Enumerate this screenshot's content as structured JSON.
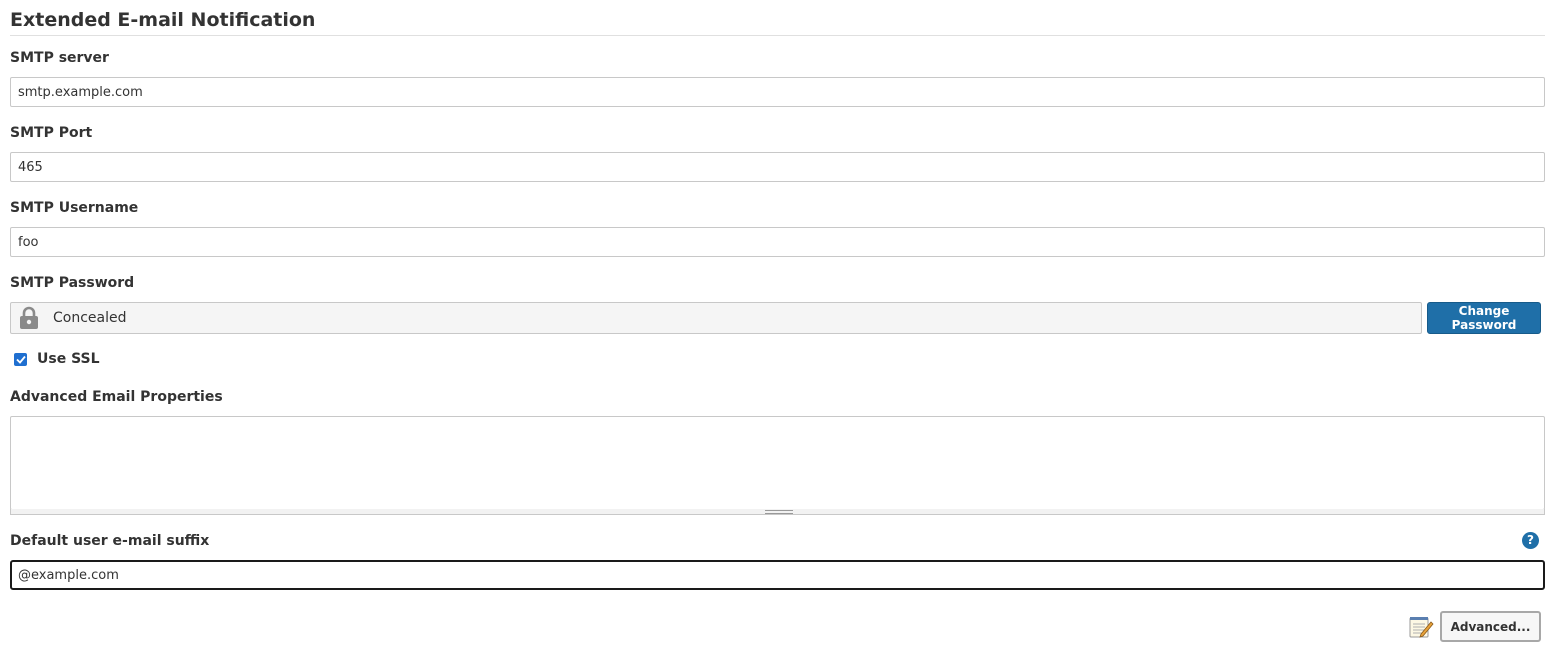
{
  "section": {
    "title": "Extended E-mail Notification"
  },
  "smtp_server": {
    "label": "SMTP server",
    "value": "smtp.example.com"
  },
  "smtp_port": {
    "label": "SMTP Port",
    "value": "465"
  },
  "smtp_username": {
    "label": "SMTP Username",
    "value": "foo"
  },
  "smtp_password": {
    "label": "SMTP Password",
    "concealed_text": "Concealed",
    "change_button_label": "Change Password",
    "lock_icon": "lock-icon"
  },
  "use_ssl": {
    "label": "Use SSL",
    "checked": true
  },
  "advanced_email_properties": {
    "label": "Advanced Email Properties",
    "value": ""
  },
  "default_suffix": {
    "label": "Default user e-mail suffix",
    "value": "@example.com",
    "help_glyph": "?"
  },
  "footer": {
    "advanced_button_label": "Advanced..."
  },
  "colors": {
    "primary_button": "#1f6fa8",
    "checkbox": "#1f6fd0",
    "help_icon": "#1f6fa8"
  }
}
